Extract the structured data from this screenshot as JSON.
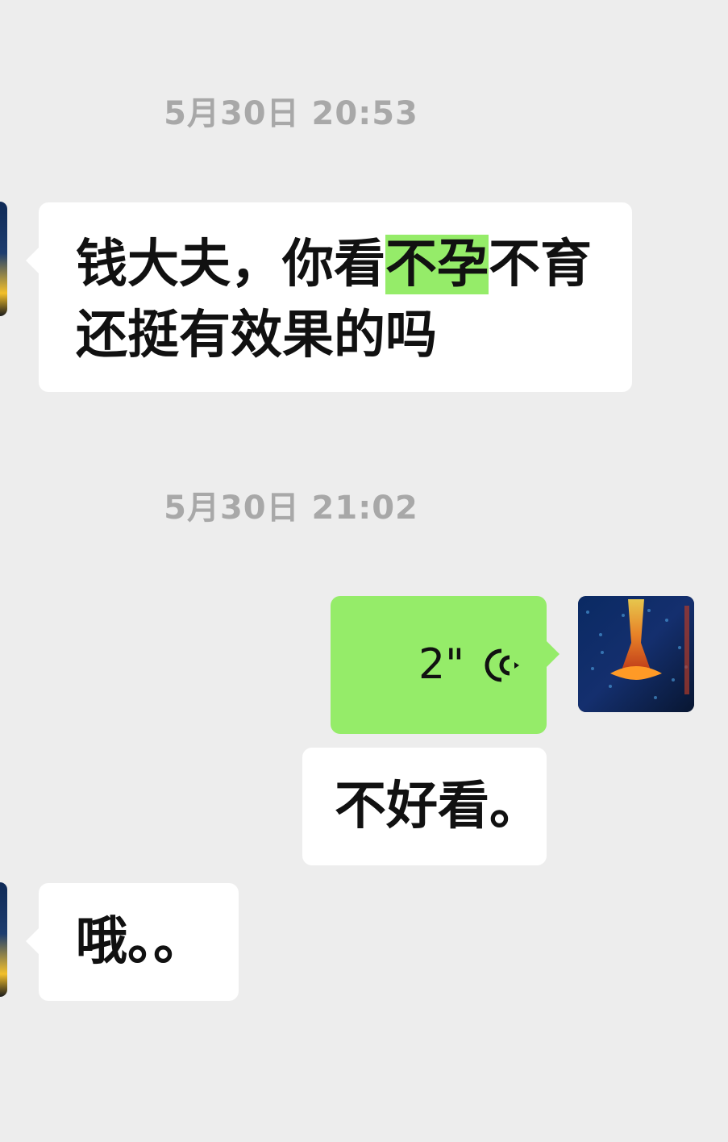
{
  "timestamps": [
    "5月30日 20:53",
    "5月30日 21:02"
  ],
  "messages": {
    "m1": {
      "line1_part1": "钱大夫，你看",
      "line1_highlight": "不孕",
      "line1_part2": "不育",
      "line2": "还挺有效果的吗"
    },
    "voice": {
      "duration": "2\"",
      "icon": "voice-wave-icon"
    },
    "m3": "不好看。",
    "m4": "哦。。"
  },
  "colors": {
    "background": "#ededed",
    "incoming_bubble": "#ffffff",
    "outgoing_voice_bubble": "#95ec69",
    "highlight": "#95ec69",
    "timestamp_text": "#a8a8a8"
  }
}
